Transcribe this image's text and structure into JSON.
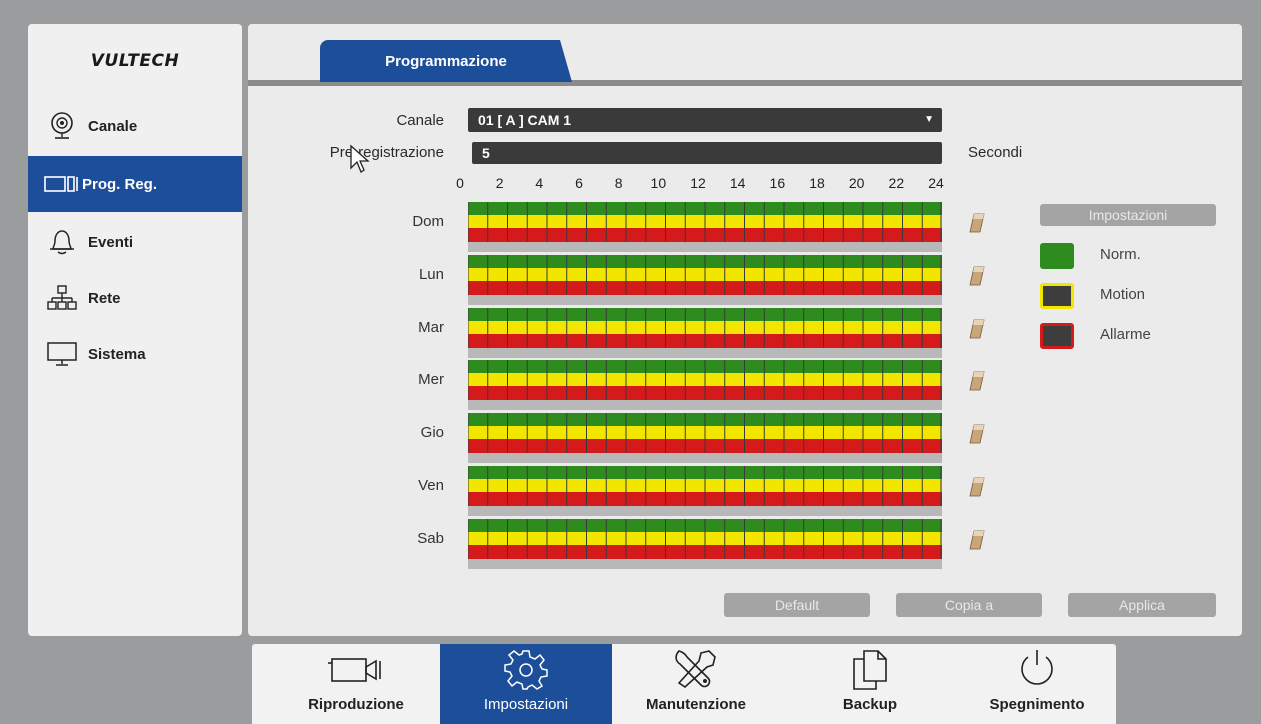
{
  "brand": "VULTECH",
  "sidebar": {
    "items": [
      {
        "label": "Canale",
        "icon": "webcam-icon",
        "active": false
      },
      {
        "label": "Prog. Reg.",
        "icon": "schedule-icon",
        "active": true
      },
      {
        "label": "Eventi",
        "icon": "bell-icon",
        "active": false
      },
      {
        "label": "Rete",
        "icon": "network-icon",
        "active": false
      },
      {
        "label": "Sistema",
        "icon": "monitor-icon",
        "active": false
      }
    ]
  },
  "tab": {
    "label": "Programmazione"
  },
  "form": {
    "canale_label": "Canale",
    "canale_value": "01 [ A ] CAM 1",
    "prereg_label": "Pre-registrazione",
    "prereg_value": "5",
    "prereg_unit": "Secondi"
  },
  "schedule": {
    "hours": [
      "0",
      "2",
      "4",
      "6",
      "8",
      "10",
      "12",
      "14",
      "16",
      "18",
      "20",
      "22",
      "24"
    ],
    "days": [
      "Dom",
      "Lun",
      "Mar",
      "Mer",
      "Gio",
      "Ven",
      "Sab"
    ],
    "slots_per_day": 24,
    "colors": {
      "norm": "#2e8b1e",
      "motion": "#f2e600",
      "allarme": "#d41a1a",
      "empty": "#b8b8b8",
      "divider": "#3a3a3a"
    }
  },
  "legend": {
    "button": "Impostazioni",
    "items": [
      {
        "label": "Norm.",
        "color": "#2e8b1e"
      },
      {
        "label": "Motion",
        "color": "#3d3d3d",
        "border": "#f2e600"
      },
      {
        "label": "Allarme",
        "color": "#3d3d3d",
        "border": "#d41a1a"
      }
    ]
  },
  "buttons": {
    "default": "Default",
    "copy": "Copia a",
    "apply": "Applica"
  },
  "bottom_bar": {
    "items": [
      {
        "label": "Riproduzione",
        "icon": "camera-icon",
        "active": false
      },
      {
        "label": "Impostazioni",
        "icon": "gear-icon",
        "active": true
      },
      {
        "label": "Manutenzione",
        "icon": "tools-icon",
        "active": false
      },
      {
        "label": "Backup",
        "icon": "copy-icon",
        "active": false
      },
      {
        "label": "Spegnimento",
        "icon": "power-icon",
        "active": false
      }
    ]
  }
}
